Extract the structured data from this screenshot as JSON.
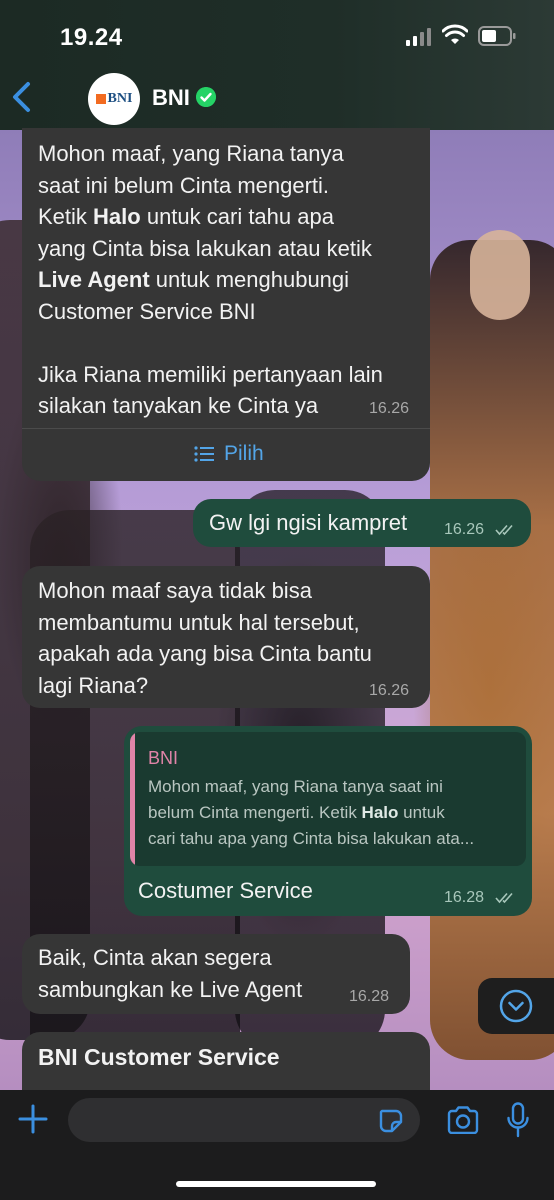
{
  "status_bar": {
    "time": "19.24"
  },
  "header": {
    "contact_name": "BNI",
    "avatar_logo_text": "BNI",
    "verified": true
  },
  "messages": [
    {
      "direction": "incoming",
      "lines": [
        "Mohon maaf,  yang Riana tanya",
        "saat ini belum Cinta mengerti.",
        [
          "Ketik ",
          {
            "bold": "Halo"
          },
          " untuk cari tahu apa"
        ],
        "yang Cinta bisa lakukan atau ketik",
        [
          {
            "bold": "Live Agent"
          },
          " untuk menghubungi"
        ],
        "Customer Service BNI",
        "",
        "Jika Riana memiliki pertanyaan lain",
        "silakan tanyakan ke Cinta ya"
      ],
      "time": "16.26",
      "action_label": "Pilih"
    },
    {
      "direction": "outgoing",
      "text": "Gw lgi ngisi kampret",
      "time": "16.26",
      "read": true
    },
    {
      "direction": "incoming",
      "text": "Mohon maaf saya tidak bisa\nmembantumu untuk hal tersebut,\napakah ada yang bisa Cinta bantu\nlagi Riana?",
      "time": "16.26"
    },
    {
      "direction": "outgoing",
      "quote": {
        "author": "BNI",
        "line1": "Mohon maaf,  yang Riana tanya saat ini",
        "line2_pre": "belum Cinta mengerti. Ketik ",
        "line2_bold": "Halo",
        "line2_post": " untuk",
        "line3": "cari tahu apa yang Cinta bisa lakukan ata..."
      },
      "text": "Costumer Service",
      "time": "16.28",
      "read": true
    },
    {
      "direction": "incoming",
      "text": "Baik, Cinta akan segera\nsambungkan ke Live Agent",
      "time": "16.28"
    },
    {
      "direction": "incoming",
      "title": "BNI Customer Service"
    }
  ],
  "colors": {
    "incoming_bubble": "#363636",
    "outgoing_bubble": "#1f4c3d",
    "accent_link": "#53a5e8",
    "quote_author": "#e084a8",
    "verified_badge": "#25d366"
  },
  "icons": {
    "back": "chevron-left-icon",
    "verified": "check-badge-icon",
    "list": "list-icon",
    "scroll_down": "chevron-down-circle-icon",
    "attach": "plus-icon",
    "sticker": "sticker-icon",
    "camera": "camera-icon",
    "mic": "microphone-icon"
  }
}
